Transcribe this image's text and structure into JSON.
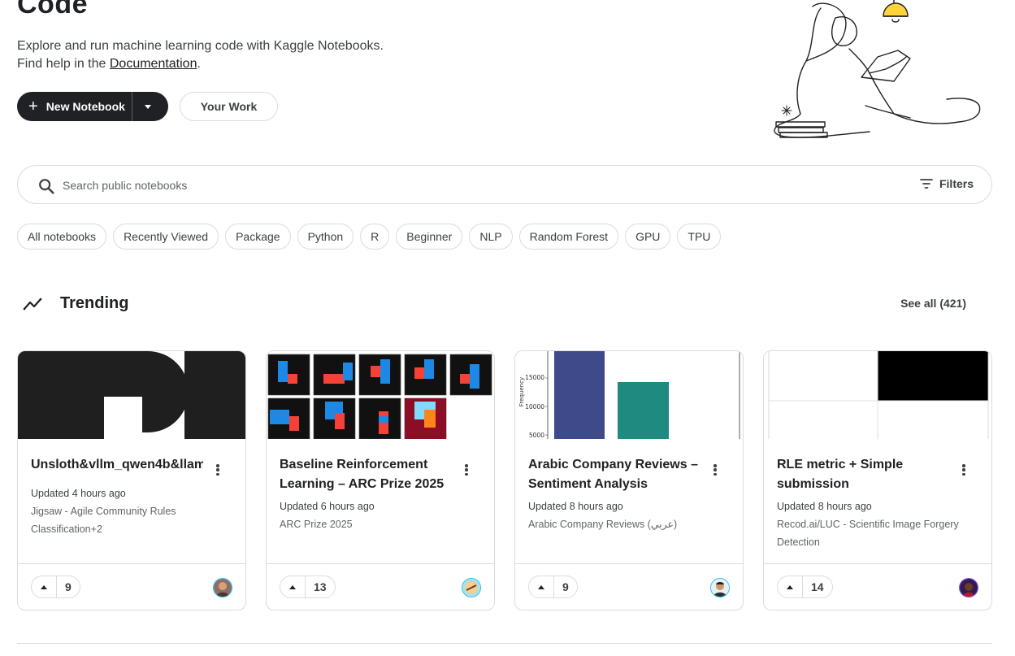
{
  "hero": {
    "title": "Code",
    "description": "Explore and run machine learning code with Kaggle Notebooks.",
    "help_prefix": "Find help in the ",
    "help_link": "Documentation",
    "help_suffix": ".",
    "new_notebook": "New Notebook",
    "your_work": "Your Work"
  },
  "search": {
    "placeholder": "Search public notebooks",
    "filters": "Filters"
  },
  "chips": [
    "All notebooks",
    "Recently Viewed",
    "Package",
    "Python",
    "R",
    "Beginner",
    "NLP",
    "Random Forest",
    "GPU",
    "TPU"
  ],
  "trending": {
    "title": "Trending",
    "see_all": "See all (421)"
  },
  "cards": [
    {
      "title": "Unsloth&vllm_qwen4b&llam",
      "updated": "Updated 4 hours ago",
      "competition": "Jigsaw - Agile Community Rules",
      "competition2": "Classification+2",
      "votes": "9"
    },
    {
      "title": "Baseline Reinforcement Learning – ARC Prize 2025",
      "updated": "Updated 6 hours ago",
      "competition": "ARC Prize 2025",
      "votes": "13"
    },
    {
      "title": "Arabic Company Reviews – Sentiment Analysis",
      "updated": "Updated 8 hours ago",
      "competition": "Arabic Company Reviews (عربي)",
      "votes": "9",
      "chart_ylabel": "Frequency",
      "chart_ticks": [
        "15000",
        "10000",
        "5000"
      ]
    },
    {
      "title": "RLE metric + Simple submission",
      "updated": "Updated 8 hours ago",
      "competition": "Recod.ai/LUC - Scientific Image Forgery",
      "competition2": "Detection",
      "votes": "14"
    }
  ],
  "colors": {
    "brand_dark": "#202124",
    "avatar_ring": "#20beff",
    "arc_blue": "#1e88e5",
    "arc_red": "#f44336",
    "bar_blue": "#3e4a89",
    "bar_teal": "#1f8a7f"
  }
}
